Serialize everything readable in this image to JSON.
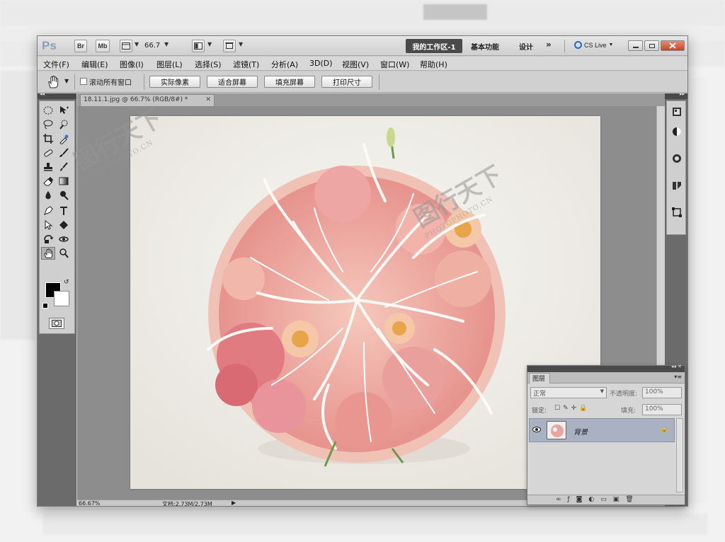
{
  "window": {
    "logo": "Ps",
    "bridge_button": "Br",
    "minibridge_button": "Mb",
    "zoom_value": "66.7",
    "workspace_active": "我的工作区-1",
    "workspace_items": [
      "基本功能",
      "设计"
    ],
    "more_glyph": "»",
    "cslive_label": "CS Live"
  },
  "menubar": {
    "items": [
      "文件(F)",
      "编辑(E)",
      "图像(I)",
      "图层(L)",
      "选择(S)",
      "滤镜(T)",
      "分析(A)",
      "3D(D)",
      "视图(V)",
      "窗口(W)",
      "帮助(H)"
    ]
  },
  "options": {
    "scroll_all_label": "滚动所有窗口",
    "buttons": [
      "实际像素",
      "适合屏幕",
      "填充屏幕",
      "打印尺寸"
    ]
  },
  "document": {
    "tab_title": "18.11.1.jpg @ 66.7% (RGB/8#) *",
    "tab_close": "✕"
  },
  "status": {
    "zoom": "66.67%",
    "doc_size": "文档:2.73M/2.73M"
  },
  "layers_panel": {
    "tab_label": "图层",
    "blend_mode": "正常",
    "opacity_label": "不透明度:",
    "opacity_value": "100%",
    "lock_label": "锁定:",
    "fill_label": "填充:",
    "fill_value": "100%",
    "layer_name": "背景"
  },
  "watermark": {
    "brand": "图行天下",
    "site": "PHOTOPHOTO.CN"
  },
  "colors": {
    "window_bg": "#c8c8c8",
    "workspace_active_bg": "#4a4a4a",
    "close_button": "#c9462a",
    "panel_dark": "#6b6b6b",
    "canvas_bg": "#f1efe9",
    "layer_selected": "#aab1c3"
  }
}
